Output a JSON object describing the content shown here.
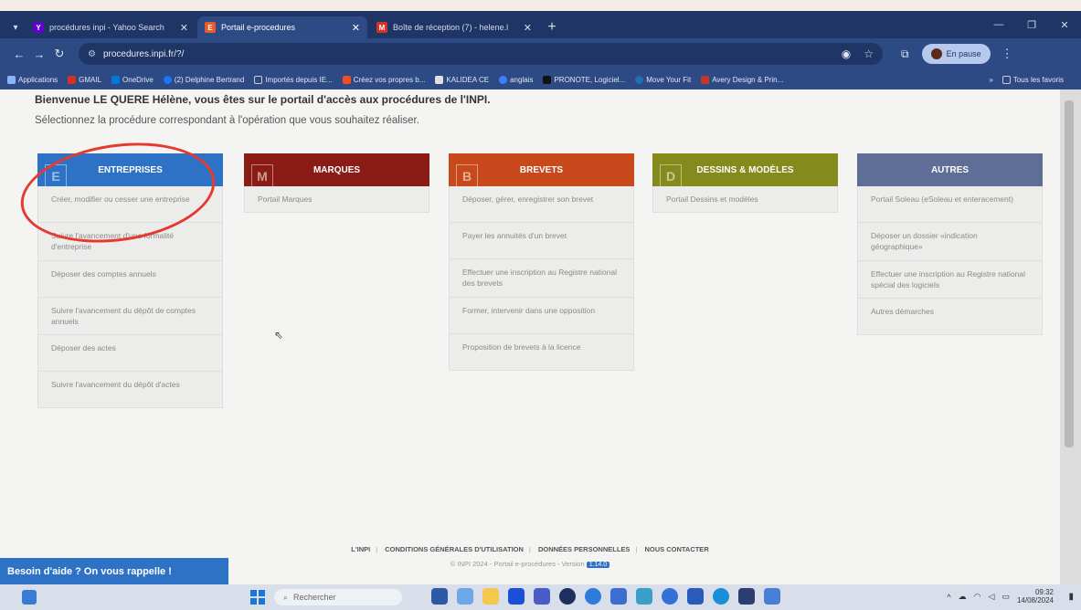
{
  "browser": {
    "tabs": [
      {
        "label": "procédures inpi - Yahoo Search",
        "favicon": "Y",
        "favicon_color": "#6001d2",
        "active": false
      },
      {
        "label": "Portail e-procedures",
        "favicon": "E",
        "favicon_color": "#e8592c",
        "active": true
      },
      {
        "label": "Boîte de réception (7) - helene.l",
        "favicon": "M",
        "favicon_color": "#d93025",
        "active": false
      }
    ],
    "url": "procedures.inpi.fr/?/",
    "profile_label": "En pause",
    "bookmarks": [
      {
        "label": "Applications",
        "color": "#8ab4f8"
      },
      {
        "label": "GMAIL",
        "color": "#d93025"
      },
      {
        "label": "OneDrive",
        "color": "#0078d4"
      },
      {
        "label": "(2) Delphine Bertrand",
        "color": "#1877f2"
      },
      {
        "label": "Importés depuis IE...",
        "color": "#cccccc"
      },
      {
        "label": "Créez vos propres b...",
        "color": "#f04e23"
      },
      {
        "label": "KALIDEA CE",
        "color": "#333333"
      },
      {
        "label": "anglais",
        "color": "#3b82f6"
      },
      {
        "label": "PRONOTE, Logiciel...",
        "color": "#222222"
      },
      {
        "label": "Move Your Fit",
        "color": "#1f6fb2"
      },
      {
        "label": "Avery Design & Prin...",
        "color": "#c0392b"
      }
    ],
    "bookmarks_more": "»",
    "all_bookmarks": "Tous les favoris"
  },
  "page": {
    "welcome": "Bienvenue LE QUERE Hélène, vous êtes sur le portail d'accès aux procédures de l'INPI.",
    "subtitle": "Sélectionnez la procédure correspondant à l'opération que vous souhaitez réaliser.",
    "columns": [
      {
        "title": "ENTREPRISES",
        "letter": "E",
        "items": [
          "Créer, modifier ou cesser une entreprise",
          "Suivre l'avancement d'une formalité d'entreprise",
          "Déposer des comptes annuels",
          "Suivre l'avancement du dépôt de comptes annuels",
          "Déposer des actes",
          "Suivre l'avancement du dépôt d'actes"
        ]
      },
      {
        "title": "MARQUES",
        "letter": "M",
        "items": [
          "Portail Marques"
        ]
      },
      {
        "title": "BREVETS",
        "letter": "B",
        "items": [
          "Déposer, gérer, enregistrer son brevet",
          "Payer les annuités d'un brevet",
          "Effectuer une inscription au Registre national des brevets",
          "Former, intervenir dans une opposition",
          "Proposition de brevets à la licence"
        ]
      },
      {
        "title": "DESSINS & MODÈLES",
        "letter": "D",
        "items": [
          "Portail Dessins et modèles"
        ]
      },
      {
        "title": "AUTRES",
        "letter": "",
        "items": [
          "Portail Soleau (eSoleau et enteracement)",
          "Déposer un dossier «indication géographique»",
          "Effectuer une inscription au Registre national spécial des logiciels",
          "Autres démarches"
        ]
      }
    ],
    "footer_links": [
      "L'INPI",
      "CONDITIONS GÉNÉRALES D'UTILISATION",
      "DONNÉES PERSONNELLES",
      "NOUS CONTACTER"
    ],
    "footer_copy": "© INPI 2024 - Portail e-procédures - Version",
    "version": "1.14.0",
    "help_button": "Besoin d'aide ? On vous rappelle !"
  },
  "taskbar": {
    "search_placeholder": "Rechercher",
    "time": "09:32",
    "date": "14/08/2024"
  }
}
